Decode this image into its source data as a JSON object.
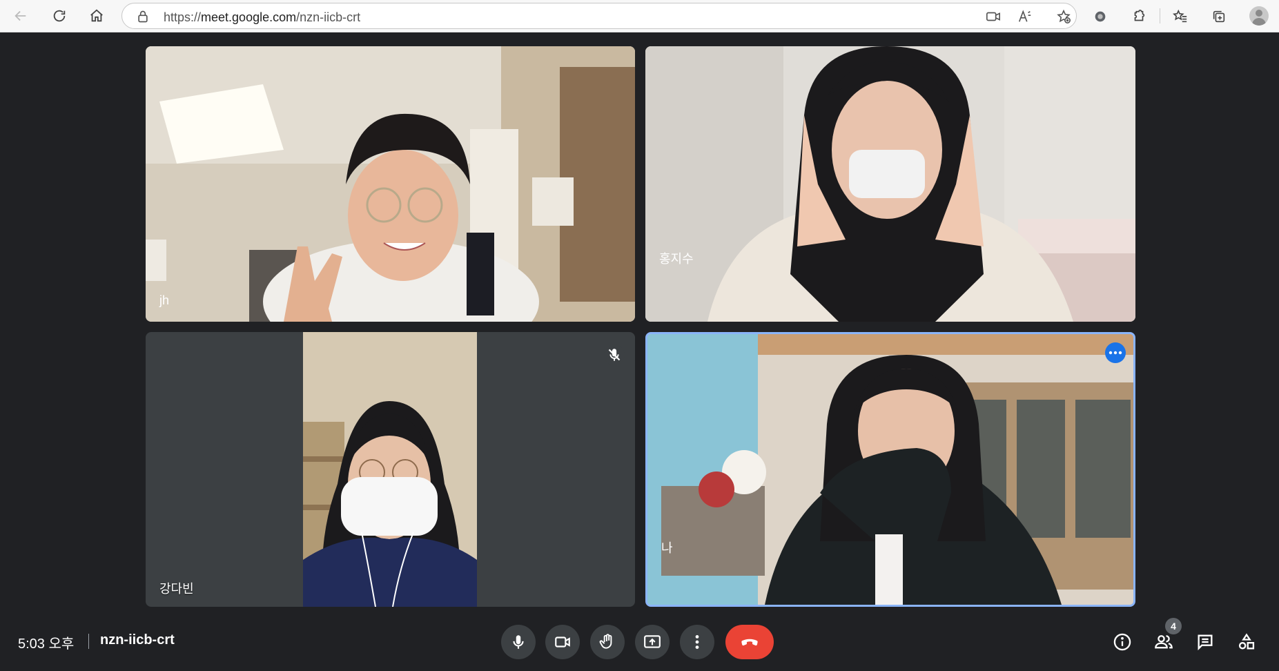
{
  "browser": {
    "url_prefix": "https://",
    "url_host": "meet.google.com",
    "url_path": "/nzn-iicb-crt"
  },
  "participants": [
    {
      "name": "jh"
    },
    {
      "name": "홍지수"
    },
    {
      "name": "강다빈",
      "muted": true
    },
    {
      "name": "나",
      "active_speaker": true
    }
  ],
  "footer": {
    "time": "5:03 오후",
    "meeting_code": "nzn-iicb-crt",
    "people_count": "4"
  },
  "colors": {
    "background": "#202124",
    "tile": "#3c4043",
    "hangup": "#ea4335",
    "active_border": "#8ab4f8",
    "more_dot": "#1a73e8"
  },
  "icons": {
    "controls": [
      "mic-icon",
      "camera-icon",
      "raise-hand-icon",
      "present-screen-icon",
      "more-options-icon",
      "hang-up-icon"
    ],
    "right": [
      "info-icon",
      "people-icon",
      "chat-icon",
      "activities-icon"
    ]
  }
}
